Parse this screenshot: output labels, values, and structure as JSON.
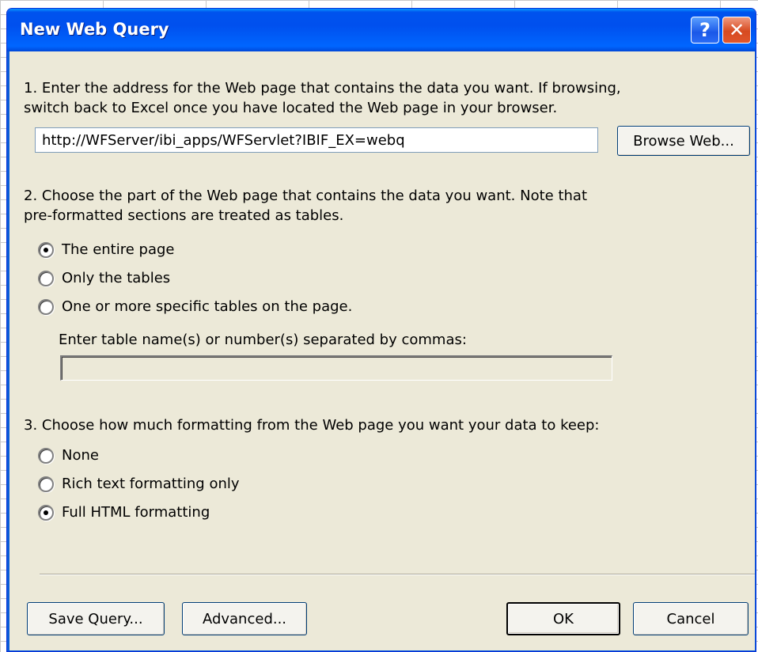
{
  "window": {
    "title": "New Web Query",
    "help_label": "?",
    "close_label": "✕"
  },
  "step1": {
    "line1": "1. Enter the address for the Web page that contains the data you want.  If browsing,",
    "line2": "switch back to Excel once you have located the Web page in your browser.",
    "address_value": "http://WFServer/ibi_apps/WFServlet?IBIF_EX=webq",
    "browse_label": "Browse Web..."
  },
  "step2": {
    "line1": "2. Choose the part of the Web page that contains the data you want.  Note that",
    "line2": "pre-formatted sections are treated as tables.",
    "options": [
      {
        "label": "The entire page",
        "selected": true
      },
      {
        "label": "Only the tables",
        "selected": false
      },
      {
        "label": "One or more specific tables on the page.",
        "selected": false
      }
    ],
    "tables_label": "Enter table name(s) or number(s) separated by commas:",
    "tables_value": ""
  },
  "step3": {
    "line1": "3. Choose how much formatting from the Web page you want your data to keep:",
    "options": [
      {
        "label": "None",
        "selected": false
      },
      {
        "label": "Rich text formatting only",
        "selected": false
      },
      {
        "label": "Full HTML formatting",
        "selected": true
      }
    ]
  },
  "buttons": {
    "save_query": "Save Query...",
    "advanced": "Advanced...",
    "ok": "OK",
    "cancel": "Cancel"
  },
  "colors": {
    "title_bar": "#0053ee",
    "dialog_face": "#ece9d8",
    "close_button": "#d64a20"
  }
}
